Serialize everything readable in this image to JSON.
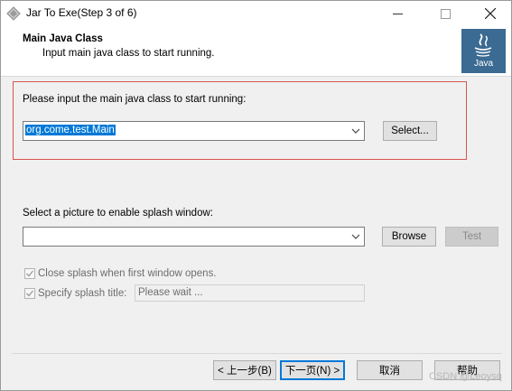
{
  "window": {
    "title": "Jar To Exe(Step 3 of 6)",
    "controls": {
      "minimize": "minimize",
      "maximize": "maximize",
      "close": "close"
    }
  },
  "header": {
    "title": "Main Java Class",
    "subtitle": "Input main java class to start running.",
    "logo_text": "Java"
  },
  "main_class": {
    "label": "Please input the main java class to start running:",
    "value": "org.come.test.Main",
    "select_label": "Select..."
  },
  "splash": {
    "label": "Select a picture to enable splash window:",
    "value": "",
    "browse_label": "Browse",
    "test_label": "Test",
    "close_splash_label": "Close splash when first window opens.",
    "close_splash_checked": true,
    "specify_title_label": "Specify splash title:",
    "specify_title_checked": true,
    "title_placeholder": "Please wait ..."
  },
  "footer": {
    "back_label": "< 上一步(B)",
    "next_label": "下一页(N) >",
    "cancel_label": "取消",
    "help_label": "帮助"
  },
  "watermark": "CSDN @Leoysq"
}
